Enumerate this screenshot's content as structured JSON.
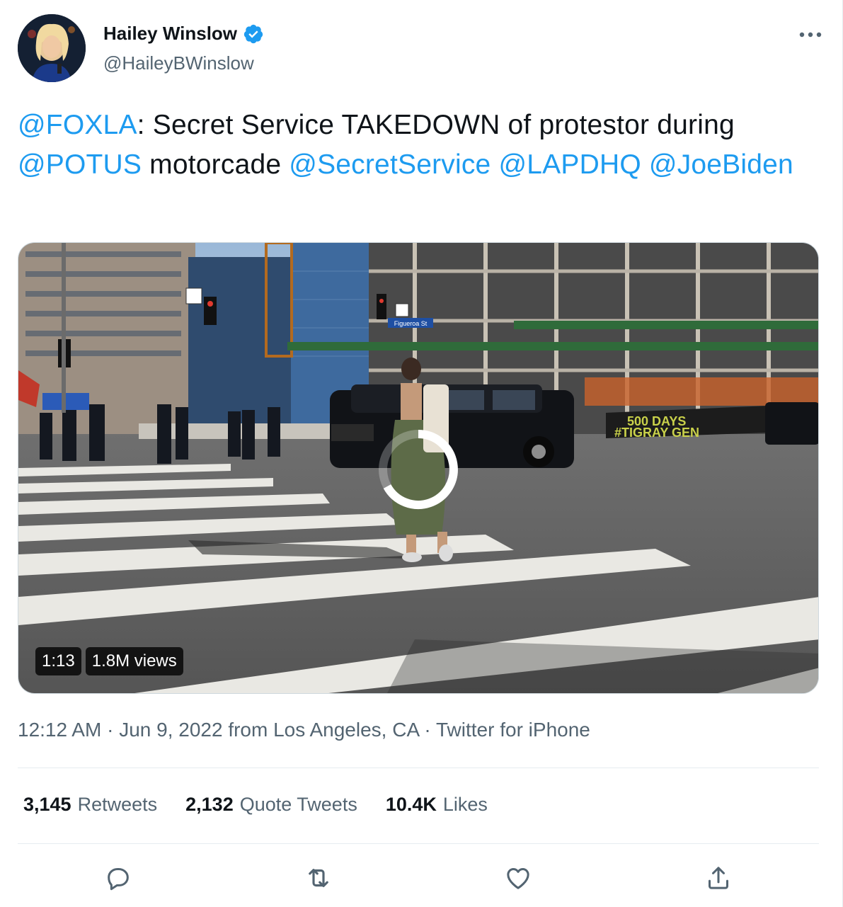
{
  "author": {
    "display_name": "Hailey Winslow",
    "handle": "@HaileyBWinslow",
    "verified": true,
    "avatar_icon": "avatar-photo"
  },
  "tweet": {
    "segments": [
      {
        "text": "@FOXLA",
        "type": "mention"
      },
      {
        "text": ": Secret Service TAKEDOWN of protestor during ",
        "type": "text"
      },
      {
        "text": "@POTUS",
        "type": "mention"
      },
      {
        "text": " motorcade ",
        "type": "text"
      },
      {
        "text": "@SecretService",
        "type": "mention"
      },
      {
        "text": " ",
        "type": "text"
      },
      {
        "text": "@LAPDHQ",
        "type": "mention"
      },
      {
        "text": " ",
        "type": "text"
      },
      {
        "text": "@JoeBiden",
        "type": "mention"
      }
    ]
  },
  "video": {
    "duration": "1:13",
    "views": "1.8M views",
    "sign_street": "Figueroa St",
    "banner_line1": "500 DAYS",
    "banner_line2": "#TIGRAY GEN"
  },
  "meta": {
    "time": "12:12 AM",
    "sep1": " · ",
    "date": "Jun 9, 2022",
    "from_word": " from ",
    "location": "Los Angeles, CA",
    "sep2": " · ",
    "client": "Twitter for iPhone"
  },
  "stats": {
    "retweets_count": "3,145",
    "retweets_label": "Retweets",
    "quotes_count": "2,132",
    "quotes_label": "Quote Tweets",
    "likes_count": "10.4K",
    "likes_label": "Likes"
  },
  "colors": {
    "accent": "#1d9bf0",
    "secondary_text": "#536471",
    "primary_text": "#0f1419",
    "divider": "#e6ecf0"
  },
  "icons": [
    "verified-badge-icon",
    "more-icon",
    "reply-icon",
    "retweet-icon",
    "like-icon",
    "share-icon"
  ]
}
